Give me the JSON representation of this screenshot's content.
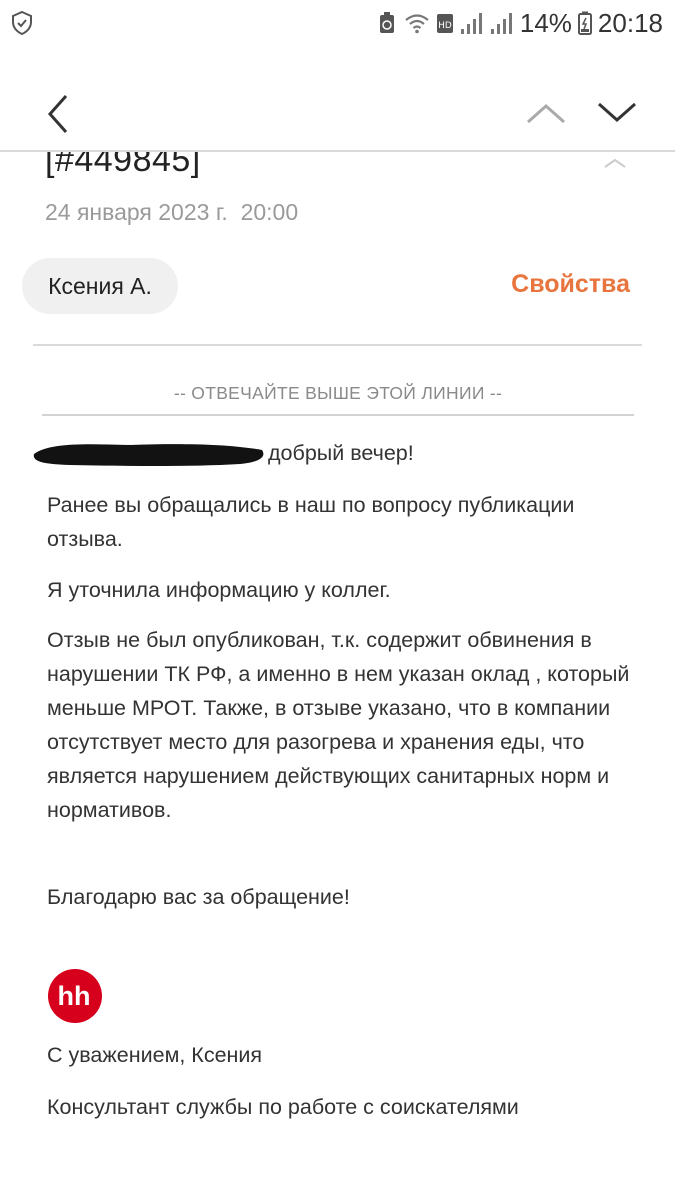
{
  "status_bar": {
    "battery_percent": "14%",
    "time": "20:18",
    "icons": [
      "shield-check-icon",
      "recycle-icon",
      "wifi-icon",
      "hd-icon",
      "signal-icon",
      "signal-icon",
      "battery-charging-icon"
    ]
  },
  "nav": {
    "icons": [
      "back-arrow-icon",
      "chevron-up-icon",
      "chevron-down-icon"
    ]
  },
  "header": {
    "subject": "[#449845]",
    "date": "24 января 2023 г.  20:00",
    "sender": "Ксения А.",
    "properties_label": "Свойства"
  },
  "message": {
    "reply_line": "-- ОТВЕЧАЙТЕ ВЫШЕ ЭТОЙ ЛИНИИ --",
    "greeting": "добрый вечер!",
    "p1": "Ранее вы обращались в наш по вопросу публикации отзыва.",
    "p2": "Я уточнила информацию у коллег.",
    "p3": "Отзыв не был опубликован, т.к. содержит обвинения в нарушении ТК РФ, а именно в нем указан оклад , который меньше МРОТ. Также, в отзыве указано, что в компании отсутствует место для разогрева и хранения еды, что является нарушением действующих санитарных норм и нормативов.",
    "p4": "Благодарю вас за обращение!",
    "logo_text": "hh",
    "signature_line1": "С уважением, Ксения",
    "signature_line2": "Консультант службы по работе с соискателями"
  },
  "colors": {
    "accent": "#e8753e",
    "logo_red": "#d6001c",
    "muted_text": "#9a9a9a",
    "divider": "#dadada"
  }
}
